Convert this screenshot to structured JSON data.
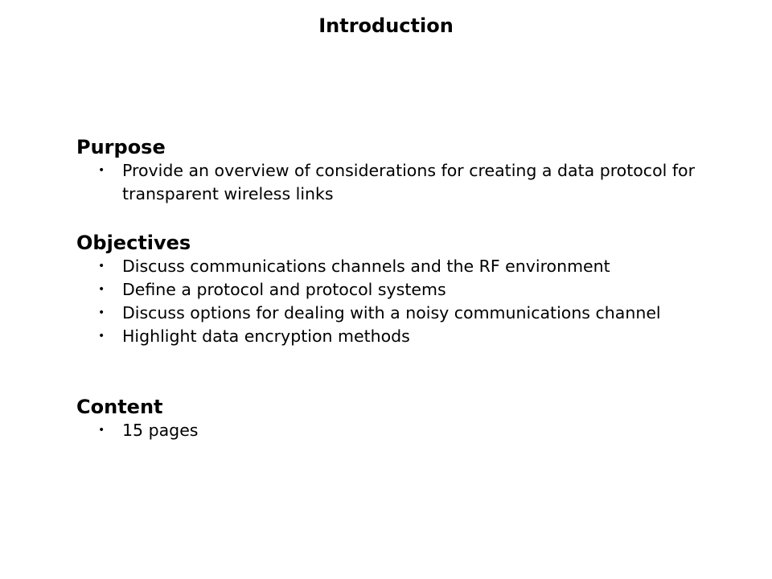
{
  "title": "Introduction",
  "sections": [
    {
      "heading": "Purpose",
      "bullets": [
        "Provide an overview of considerations for creating a data protocol for transparent wireless links"
      ]
    },
    {
      "heading": "Objectives",
      "bullets": [
        "Discuss communications channels and the RF environment",
        "Define a protocol and protocol systems",
        "Discuss options for dealing with a noisy communications channel",
        "Highlight data encryption methods"
      ]
    },
    {
      "heading": "Content",
      "bullets": [
        "15 pages"
      ]
    }
  ],
  "bullet_glyph": "•"
}
